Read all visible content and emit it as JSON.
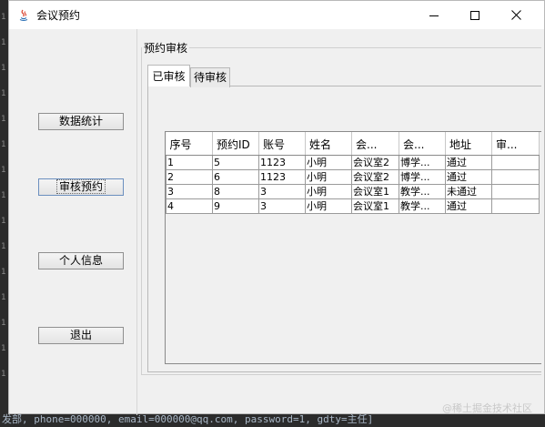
{
  "ide": {
    "gutter_marks": [
      "1",
      "1",
      "1",
      "1",
      "1",
      "1",
      "1",
      "1",
      "1",
      "1",
      "1",
      "1",
      "1",
      "1",
      "1"
    ],
    "bottom_line": "发部, phone=000000, email=000000@qq.com, password=1, gdty=主任]"
  },
  "window": {
    "title": "会议预约"
  },
  "sidebar": {
    "buttons": [
      {
        "label": "数据统计"
      },
      {
        "label": "审核预约"
      },
      {
        "label": "个人信息"
      },
      {
        "label": "退出"
      }
    ]
  },
  "group": {
    "title": "预约审核"
  },
  "tabs": [
    {
      "label": "已审核"
    },
    {
      "label": "待审核"
    }
  ],
  "table": {
    "headers": [
      "序号",
      "预约ID",
      "账号",
      "姓名",
      "会...",
      "会...",
      "地址",
      "审..."
    ],
    "rows": [
      [
        "1",
        "5",
        "1123",
        "小明",
        "会议室2",
        "博学...",
        "通过",
        ""
      ],
      [
        "2",
        "6",
        "1123",
        "小明",
        "会议室2",
        "博学...",
        "通过",
        ""
      ],
      [
        "3",
        "8",
        "3",
        "小明",
        "会议室1",
        "教学...",
        "未通过",
        ""
      ],
      [
        "4",
        "9",
        "3",
        "小明",
        "会议室1",
        "教学...",
        "通过",
        ""
      ]
    ]
  },
  "watermark": "@稀土掘金技术社区",
  "colors": {
    "window_bg": "#f0f0f0",
    "titlebar_bg": "#ffffff",
    "ide_bg": "#2b2b2b"
  }
}
